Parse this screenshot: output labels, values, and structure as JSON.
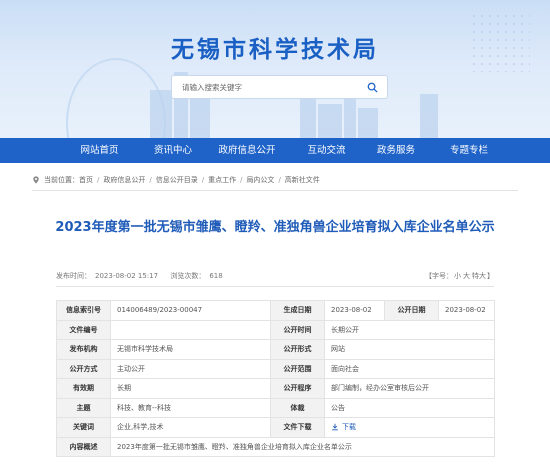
{
  "site": {
    "title": "无锡市科学技术局",
    "search_placeholder": "请输入搜索关键字",
    "search_icon": "search-icon"
  },
  "nav": [
    {
      "label": "网站首页"
    },
    {
      "label": "资讯中心"
    },
    {
      "label": "政府信息公开"
    },
    {
      "label": "互动交流"
    },
    {
      "label": "政务服务"
    },
    {
      "label": "专题专栏"
    }
  ],
  "breadcrumb": {
    "prefix": "当前位置：",
    "items": [
      "首页",
      "政府信息公开",
      "信息公开目录",
      "重点工作",
      "局内公文",
      "高新社文件"
    ]
  },
  "article": {
    "title": "2023年度第一批无锡市雏鹰、瞪羚、准独角兽企业培育拟入库企业名单公示",
    "publish_label": "发布时间：",
    "publish_time": "2023-08-02 15:17",
    "views_label": "浏览次数：",
    "views": "618",
    "font_size": {
      "label": "【字号：",
      "large": "特大",
      "medium": "大",
      "small": "小",
      "close": "】"
    }
  },
  "info_table": {
    "index_label": "信息索引号",
    "index": "014006489/2023-00047",
    "doc_no_label": "文件编号",
    "doc_no": "",
    "issuer_label": "发布机构",
    "issuer": "无锡市科学技术局",
    "open_mode_label": "公开方式",
    "open_mode": "主动公开",
    "validity_label": "有效期",
    "validity": "长期",
    "topic_label": "主题",
    "topic": "科技、教育--科技",
    "keywords_label": "关键词",
    "keywords": "企业,科学,技术",
    "summary_label": "内容概述",
    "summary": "2023年度第一批无锡市雏鹰、瞪羚、准独角兽企业培育拟入库企业名单公示",
    "gen_date_label": "生成日期",
    "gen_date": "2023-08-02",
    "pub_date_label": "公开日期",
    "pub_date": "2023-08-02",
    "open_time_label": "公开时间",
    "open_time": "长期公开",
    "open_form_label": "公开形式",
    "open_form": "网站",
    "open_scope_label": "公开范围",
    "open_scope": "面向社会",
    "open_proc_label": "公开程序",
    "open_proc": "部门编制，经办公室审核后公开",
    "genre_label": "体裁",
    "genre": "公告",
    "download_label": "文件下载",
    "download": "下载"
  },
  "colors": {
    "brand": "#1f63c9",
    "title": "#1f5bb8",
    "label_bg": "#f2f2f2"
  }
}
